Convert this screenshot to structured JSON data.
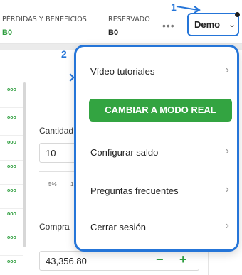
{
  "header": {
    "pl_label": "PÉRDIDAS Y BENEFICIOS",
    "pl_value": "B0",
    "reserved_label": "RESERVADO",
    "reserved_value": "B0",
    "more_glyph": "•••",
    "account_mode": "Demo",
    "chevron_glyph": "⌄"
  },
  "annotations": [
    "1",
    "2"
  ],
  "menu": {
    "items": [
      {
        "label": "Vídeo tutoriales",
        "chevron": "›"
      },
      {
        "label": "CAMBIAR A MODO REAL"
      },
      {
        "label": "Configurar saldo",
        "chevron": "›"
      },
      {
        "label": "Preguntas frecuentes",
        "chevron": "›"
      },
      {
        "label": "Cerrar sesión",
        "chevron": "›"
      }
    ]
  },
  "form": {
    "quantity_label": "Cantidad",
    "quantity_value": "10",
    "percent_options": [
      "5%",
      "1"
    ],
    "buy_label": "Compra",
    "price_value": "43,356.80",
    "minus_glyph": "−",
    "plus_glyph": "+"
  },
  "left_list": {
    "row_glyph": "ooo"
  },
  "colors": {
    "accent_blue": "#2575d8",
    "green": "#33a441",
    "profit_green": "#2e9e3e"
  },
  "icons": [
    "chevron-down-icon",
    "more-icon",
    "chevron-right-icon",
    "plus-icon",
    "minus-icon"
  ]
}
